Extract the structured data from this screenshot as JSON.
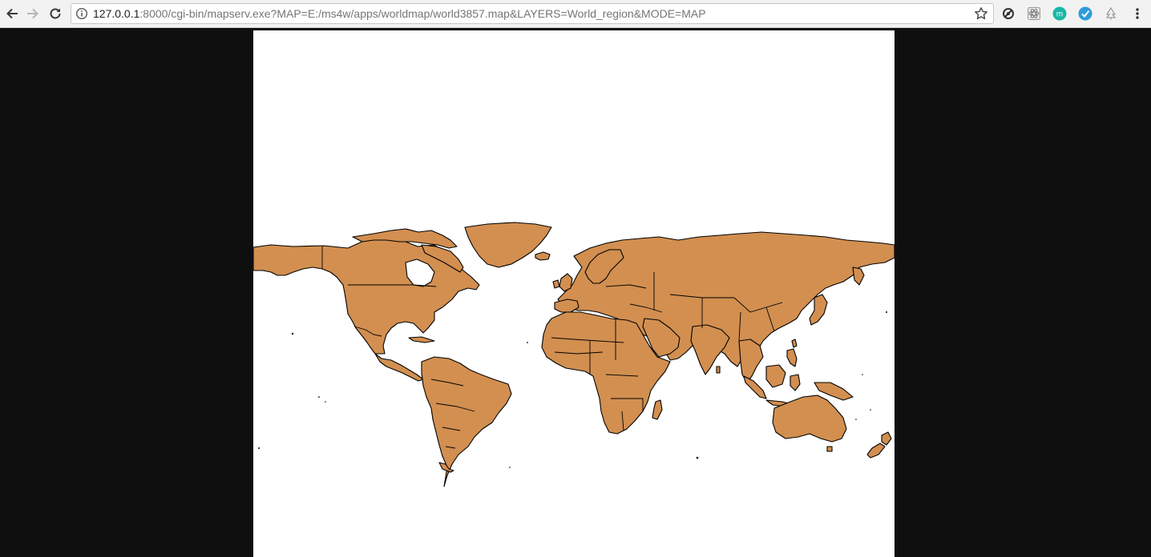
{
  "browser": {
    "url_host": "127.0.0.1",
    "url_rest": ":8000/cgi-bin/mapserv.exe?MAP=E:/ms4w/apps/worldmap/world3857.map&LAYERS=World_region&MODE=MAP",
    "icons": {
      "back": "back-arrow-icon",
      "forward": "forward-arrow-icon",
      "reload": "reload-icon",
      "info": "info-icon",
      "star": "bookmark-star-icon",
      "menu": "kebab-menu-icon"
    },
    "extensions": [
      {
        "name": "no-tracking-extension-icon",
        "color": "#333333"
      },
      {
        "name": "react-devtools-extension-icon",
        "color": "#7a7a7a"
      },
      {
        "name": "m-extension-icon",
        "color": "#19b7a5",
        "letter": "m"
      },
      {
        "name": "check-extension-icon",
        "color": "#2d9cdb"
      },
      {
        "name": "tree-extension-icon",
        "color": "#9e9e9e"
      }
    ]
  },
  "map": {
    "layer": "World_region",
    "land_color": "#d28f50",
    "border_color": "#000000",
    "background_color": "#ffffff"
  },
  "colors": {
    "page_background": "#0f0f0f",
    "toolbar_background": "#f2f2f2"
  }
}
